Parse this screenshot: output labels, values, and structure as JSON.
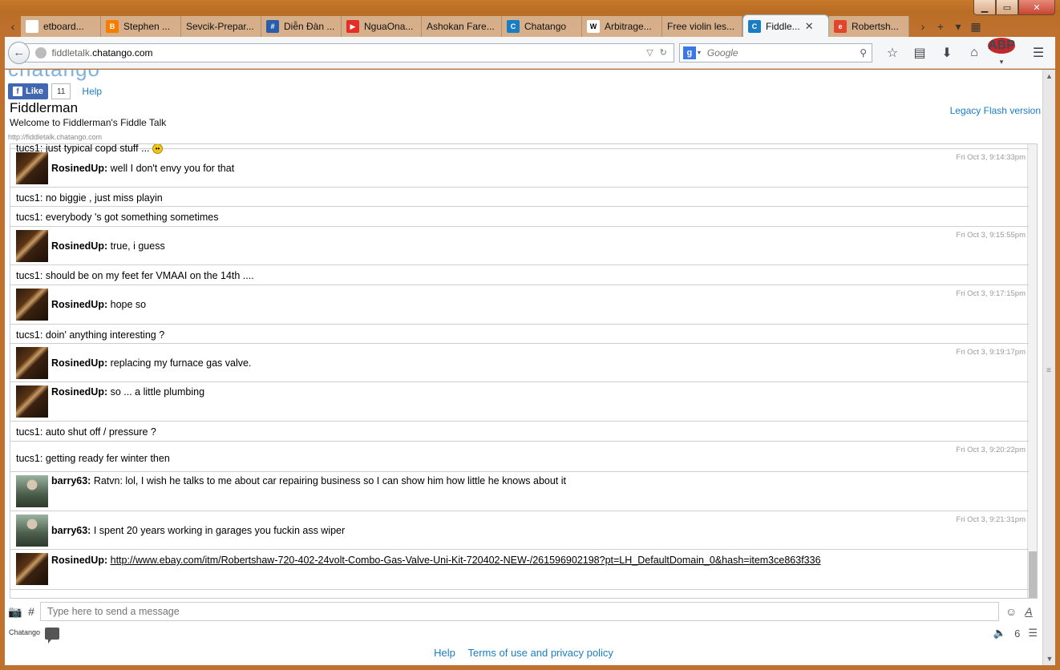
{
  "browser": {
    "tabs": [
      {
        "label": "etboard...",
        "fav_color": "#ffffff",
        "fav_glyph": ""
      },
      {
        "label": "Stephen ...",
        "fav_color": "#f57d00",
        "fav_glyph": "B"
      },
      {
        "label": "Sevcik-Prepar...",
        "fav_color": "",
        "fav_glyph": ""
      },
      {
        "label": "Diễn Đàn ...",
        "fav_color": "#2a5caa",
        "fav_glyph": "#"
      },
      {
        "label": "NguaOna...",
        "fav_color": "#e52d27",
        "fav_glyph": "▶"
      },
      {
        "label": "Ashokan Fare...",
        "fav_color": "",
        "fav_glyph": ""
      },
      {
        "label": "Chatango",
        "fav_color": "#1a7dc4",
        "fav_glyph": "C"
      },
      {
        "label": "Arbitrage...",
        "fav_color": "#ffffff",
        "fav_glyph": "W"
      },
      {
        "label": "Free violin les...",
        "fav_color": "",
        "fav_glyph": ""
      },
      {
        "label": "Fiddle...",
        "fav_color": "#1a7dc4",
        "fav_glyph": "C",
        "active": true
      },
      {
        "label": "Robertsh...",
        "fav_color": "#e0462a",
        "fav_glyph": "e"
      }
    ],
    "url_prefix": "fiddletalk.",
    "url_host": "chatango.com",
    "search_placeholder": "Google"
  },
  "room": {
    "logo_text": "chatango",
    "like_label": "Like",
    "like_count": "11",
    "help_label": "Help",
    "title": "Fiddlerman",
    "description": "Welcome to Fiddlerman's Fiddle Talk",
    "url": "http://fiddletalk.chatango.com",
    "legacy_link": "Legacy Flash version"
  },
  "messages": [
    {
      "user": "",
      "text": "tucs1: just typical copd stuff ... ",
      "avatar": "",
      "time": "",
      "smiley": true
    },
    {
      "user": "RosinedUp:",
      "text": " well I don't envy you for that",
      "avatar": "rosin",
      "time": "Fri Oct 3, 9:14:33pm"
    },
    {
      "user": "",
      "text": "tucs1: no biggie , just miss playin",
      "avatar": "",
      "time": ""
    },
    {
      "user": "",
      "text": "tucs1: everybody 's got something sometimes",
      "avatar": "",
      "time": ""
    },
    {
      "user": "RosinedUp:",
      "text": " true, i guess",
      "avatar": "rosin",
      "time": "Fri Oct 3, 9:15:55pm"
    },
    {
      "user": "",
      "text": "tucs1: should be on my feet fer VMAAI on the 14th ....",
      "avatar": "",
      "time": ""
    },
    {
      "user": "RosinedUp:",
      "text": " hope so",
      "avatar": "rosin",
      "time": "Fri Oct 3, 9:17:15pm"
    },
    {
      "user": "",
      "text": "tucs1: doin' anything interesting ?",
      "avatar": "",
      "time": ""
    },
    {
      "user": "RosinedUp:",
      "text": " replacing my furnace gas valve.",
      "avatar": "rosin",
      "time": "Fri Oct 3, 9:19:17pm"
    },
    {
      "user": "RosinedUp:",
      "text": " so ... a little plumbing",
      "avatar": "rosin",
      "time": ""
    },
    {
      "user": "",
      "text": "tucs1: auto shut off / pressure ?",
      "avatar": "",
      "time": ""
    },
    {
      "user": "",
      "text": "tucs1: getting ready fer winter then",
      "avatar": "",
      "time": "Fri Oct 3, 9:20:22pm"
    },
    {
      "user": "barry63:",
      "text": " Ratvn: lol, I wish he talks to me about car repairing business so I can show him how little he knows about it",
      "avatar": "barry",
      "time": ""
    },
    {
      "user": "barry63:",
      "text": " I spent 20 years working in garages you fuckin ass wiper",
      "avatar": "barry",
      "time": "Fri Oct 3, 9:21:31pm"
    },
    {
      "user": "RosinedUp:",
      "text": "",
      "link": "http://www.ebay.com/itm/Robertshaw-720-402-24volt-Combo-Gas-Valve-Uni-Kit-720402-NEW-/261596902198?pt=LH_DefaultDomain_0&hash=item3ce863f336",
      "avatar": "rosin",
      "time": ""
    }
  ],
  "composer": {
    "placeholder": "Type here to send a message",
    "hash": "#",
    "brand": "Chatango",
    "user_count": "6"
  },
  "footer": {
    "help": "Help",
    "terms": "Terms of use and privacy policy"
  }
}
